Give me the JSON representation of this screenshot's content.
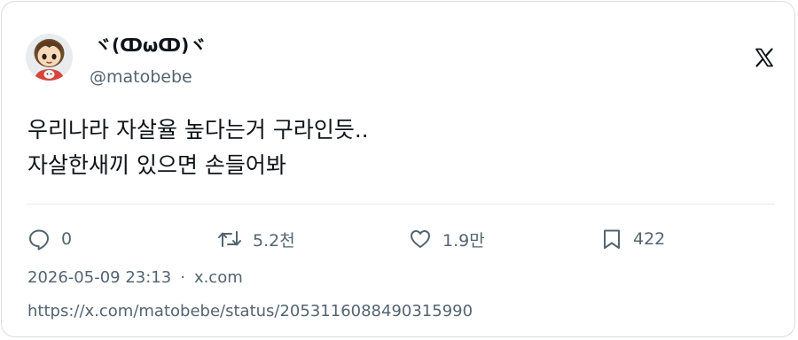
{
  "author": {
    "display_name": "ヾ(ↀωↀ)ヾ",
    "handle": "@matobebe"
  },
  "platform_logo": "x-logo-icon",
  "tweet": {
    "lines": [
      "우리나라 자살율 높다는거 구라인듯..",
      "자살한새끼 있으면 손들어봐"
    ]
  },
  "actions": {
    "reply": {
      "icon": "reply-icon",
      "count": "0"
    },
    "retweet": {
      "icon": "retweet-icon",
      "count": "5.2천"
    },
    "like": {
      "icon": "heart-icon",
      "count": "1.9만"
    },
    "bookmark": {
      "icon": "bookmark-icon",
      "count": "422"
    }
  },
  "meta": {
    "timestamp": "2026-05-09 23:13",
    "separator": "·",
    "source": "x.com"
  },
  "status_url": "https://x.com/matobebe/status/2053116088490315990",
  "colors": {
    "text_primary": "#0f1419",
    "text_secondary": "#536471",
    "border": "#d9dde1"
  }
}
